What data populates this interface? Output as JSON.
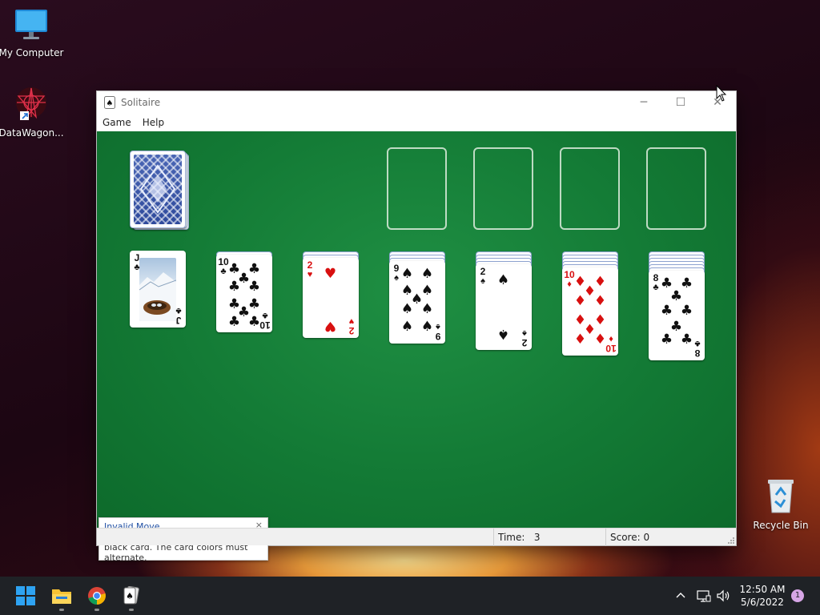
{
  "desktop": {
    "icons": [
      {
        "label": "My Computer",
        "icon": "monitor-icon"
      },
      {
        "label": "DataWagon...",
        "icon": "datawagon-shortcut-icon"
      },
      {
        "label": "Recycle Bin",
        "icon": "recycle-bin-icon"
      }
    ]
  },
  "window": {
    "title": "Solitaire",
    "menu": [
      "Game",
      "Help"
    ],
    "controls": {
      "minimize": "─",
      "maximize": "☐",
      "close": "✕"
    }
  },
  "game": {
    "stock": {
      "face_down": true
    },
    "foundations": [
      "",
      "",
      "",
      ""
    ],
    "tableau": [
      {
        "hidden": 0,
        "top": {
          "rank": "J",
          "suit": "♣",
          "color": "black",
          "face_card": true
        }
      },
      {
        "hidden": 1,
        "top": {
          "rank": "10",
          "suit": "♣",
          "color": "black"
        }
      },
      {
        "hidden": 2,
        "top": {
          "rank": "2",
          "suit": "♥",
          "color": "red"
        }
      },
      {
        "hidden": 3,
        "top": {
          "rank": "9",
          "suit": "♠",
          "color": "black"
        }
      },
      {
        "hidden": 4,
        "top": {
          "rank": "2",
          "suit": "♠",
          "color": "black"
        }
      },
      {
        "hidden": 5,
        "top": {
          "rank": "10",
          "suit": "♦",
          "color": "red"
        }
      },
      {
        "hidden": 6,
        "top": {
          "rank": "8",
          "suit": "♣",
          "color": "black"
        }
      }
    ]
  },
  "toast": {
    "title": "Invalid Move",
    "body": "You can only put a red card on a black card. The card colors must alternate.",
    "close": "×"
  },
  "status": {
    "time_label": "Time:",
    "time_value": "3",
    "score_label": "Score:",
    "score_value": "0"
  },
  "taskbar": {
    "apps": [
      "start-icon",
      "file-explorer-icon",
      "chrome-icon",
      "solitaire-icon"
    ],
    "tray": [
      "chevron-up-icon",
      "network-icon",
      "volume-icon"
    ],
    "time": "12:50 AM",
    "date": "5/6/2022",
    "notification_count": "1"
  }
}
